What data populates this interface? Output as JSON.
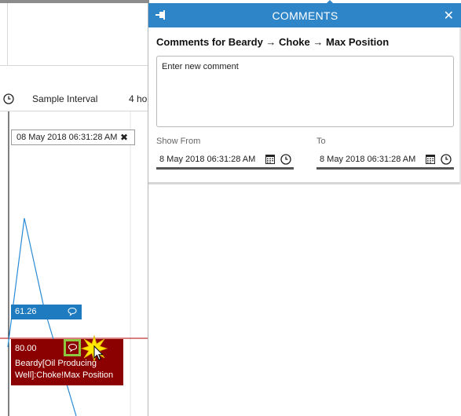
{
  "interval": {
    "label": "Sample Interval",
    "value": "4 ho"
  },
  "chart": {
    "cursor_date": "08 May 2018 06:31:28 AM",
    "tooltip_blue": {
      "value": "61.26"
    },
    "tooltip_red": {
      "value": "80.00",
      "description": "Beardy[Oil Producing Well]:Choke!Max Position"
    }
  },
  "panel": {
    "title": "COMMENTS",
    "subtitle": "Comments for Beardy → Choke → Max Position",
    "comment_placeholder": "Enter new comment",
    "show_from_label": "Show From",
    "to_label": "To",
    "show_from_value": "8 May 2018 06:31:28 AM",
    "to_value": "8 May 2018 06:31:28 AM"
  },
  "colors": {
    "header_blue": "#2e86c8",
    "tooltip_blue": "#1f7bbf",
    "tooltip_red": "#8b0000",
    "highlight_green": "#8dc63f"
  },
  "icons": [
    "pin-icon",
    "close-icon",
    "calendar-icon",
    "clock-icon",
    "comment-bubble-icon"
  ]
}
